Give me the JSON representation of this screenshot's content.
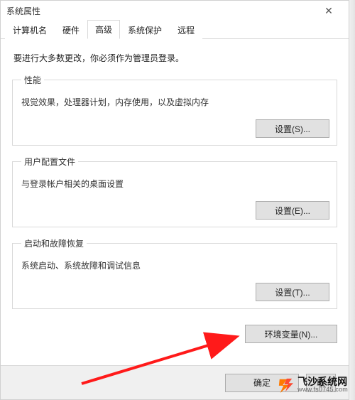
{
  "window": {
    "title": "系统属性",
    "close_icon": "✕"
  },
  "tabs": [
    {
      "label": "计算机名"
    },
    {
      "label": "硬件"
    },
    {
      "label": "高级"
    },
    {
      "label": "系统保护"
    },
    {
      "label": "远程"
    }
  ],
  "active_tab_index": 2,
  "admin_note": "要进行大多数更改，你必须作为管理员登录。",
  "sections": {
    "performance": {
      "legend": "性能",
      "desc": "视觉效果，处理器计划，内存使用，以及虚拟内存",
      "button": "设置(S)..."
    },
    "profiles": {
      "legend": "用户配置文件",
      "desc": "与登录帐户相关的桌面设置",
      "button": "设置(E)..."
    },
    "startup": {
      "legend": "启动和故障恢复",
      "desc": "系统启动、系统故障和调试信息",
      "button": "设置(T)..."
    }
  },
  "env_button": "环境变量(N)...",
  "dialog_buttons": {
    "ok": "确定",
    "cancel": "取"
  },
  "watermark": {
    "brand": "飞沙系统网",
    "url": "www.fs0745.com"
  },
  "annotation": {
    "arrow_color": "#ff1a1a"
  }
}
